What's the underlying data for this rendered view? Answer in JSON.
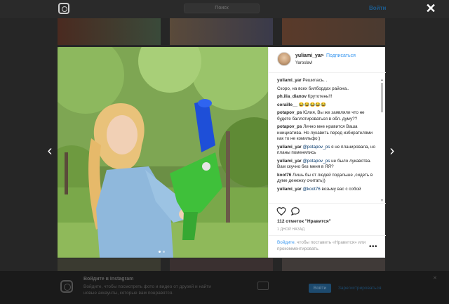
{
  "header": {
    "search_placeholder": "Поиск",
    "login_label": "Войти"
  },
  "post": {
    "username": "yuliami_yar",
    "separator": "•",
    "follow_label": "Подписаться",
    "location": "Yaroslavl",
    "comments": [
      {
        "user": "yuliami_yar",
        "text": "Решилась. ."
      },
      {
        "user": "",
        "text": "Скоро, на всех билбордах района.."
      },
      {
        "user": "ph.ilia_dianov",
        "text": "Крутотень!!!"
      },
      {
        "user": "coraille__",
        "text": "😂😂😂😂😂"
      },
      {
        "user": "potapov_ps",
        "text": "Юлия, Вы же заявляли что не будете баллотироваться в обл. думу??"
      },
      {
        "user": "potapov_ps",
        "text": "Лично мне нравится Ваша инициатива. Но лукавить перед избирателями как то не комильфо:)"
      },
      {
        "user": "yuliami_yar",
        "mention": "@potapov_ps",
        "text": "я не планировала, но планы поменялись"
      },
      {
        "user": "yuliami_yar",
        "mention": "@potapov_ps",
        "text": "не было лукавства. Вам скучно без меня в ЯЯ?"
      },
      {
        "user": "koot76",
        "text": "Лишь бы от людей подальше ,сидеть в думе денежку считать))"
      },
      {
        "user": "yuliami_yar",
        "mention": "@koot76",
        "text": "возьму вас с собой"
      }
    ],
    "likes": "112 отметок \"Нравится\"",
    "time_ago": "1 ДНОЙ НАЗАД",
    "login_prompt": {
      "link": "Войдите",
      "text": ", чтобы поставить «Нравится» или прокомментировать."
    },
    "more_label": "•••"
  },
  "banner": {
    "title": "Войдите в Instagram",
    "text": "Войдите, чтобы посмотреть фото и видео от друзей и найти новые аккаунты, которые вам понравятся.",
    "login_button": "Войти",
    "signup_link": "Зарегистрироваться",
    "close_label": "✕"
  },
  "modal_controls": {
    "close_label": "✕",
    "prev_label": "‹",
    "next_label": "›"
  },
  "colors": {
    "accent": "#3897f0",
    "mention": "#003569"
  }
}
